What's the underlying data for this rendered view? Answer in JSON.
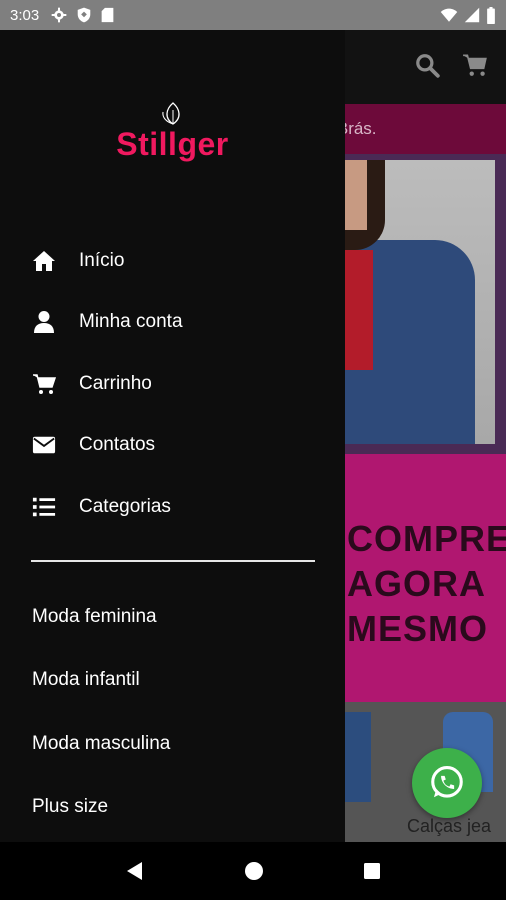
{
  "status_bar": {
    "time": "3:03"
  },
  "app": {
    "banner_text": "s do Brás.",
    "promo_lines": [
      "COMPRE",
      "AGORA",
      "MESMO"
    ],
    "product_caption": "Calças jea"
  },
  "drawer": {
    "brand": "Stillger",
    "menu": [
      {
        "label": "Início",
        "icon": "home-icon"
      },
      {
        "label": "Minha conta",
        "icon": "user-icon"
      },
      {
        "label": "Carrinho",
        "icon": "cart-icon"
      },
      {
        "label": "Contatos",
        "icon": "envelope-icon"
      },
      {
        "label": "Categorias",
        "icon": "list-icon"
      }
    ],
    "categories": [
      "Moda feminina",
      "Moda infantil",
      "Moda masculina",
      "Plus size"
    ]
  },
  "colors": {
    "brand": "#f0195f",
    "drawer_bg": "#0d0d0d",
    "whatsapp": "#3db04a",
    "promo": "#b01770"
  }
}
